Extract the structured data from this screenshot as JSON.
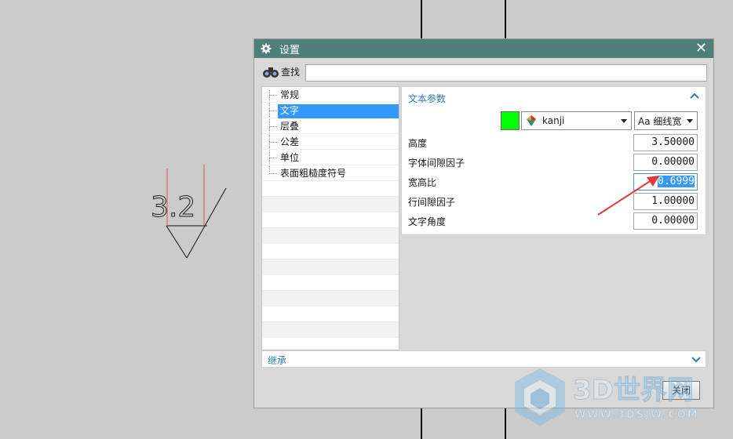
{
  "drawing": {
    "roughness_value": "3.2"
  },
  "dialog": {
    "title": "设置",
    "close_symbol": "✕",
    "search": {
      "label": "查找",
      "value": "",
      "placeholder": ""
    },
    "tree": {
      "items": [
        {
          "label": "常规",
          "selected": false
        },
        {
          "label": "文字",
          "selected": true
        },
        {
          "label": "层叠",
          "selected": false
        },
        {
          "label": "公差",
          "selected": false
        },
        {
          "label": "单位",
          "selected": false
        },
        {
          "label": "表面粗糙度符号",
          "selected": false
        }
      ]
    },
    "text_params": {
      "title": "文本参数",
      "color": "#00ff00",
      "font": "kanji",
      "width_option": "Aa 细线宽",
      "fields": [
        {
          "label": "高度",
          "value": "3.50000"
        },
        {
          "label": "字体间隙因子",
          "value": "0.00000"
        },
        {
          "label": "宽高比",
          "value": "0.6999",
          "active": true
        },
        {
          "label": "行间隙因子",
          "value": "1.00000"
        },
        {
          "label": "文字角度",
          "value": "0.00000"
        }
      ]
    },
    "inherit": {
      "title": "继承"
    },
    "close_button": "关闭"
  },
  "watermark": {
    "brand": "3D世界网",
    "url": "WWW.3DSJW.COM"
  },
  "colors": {
    "titlebar": "#4e7f7a",
    "accent": "#2a7db5",
    "selection": "#3399ff",
    "annotation_arrow": "#e03a3a"
  }
}
